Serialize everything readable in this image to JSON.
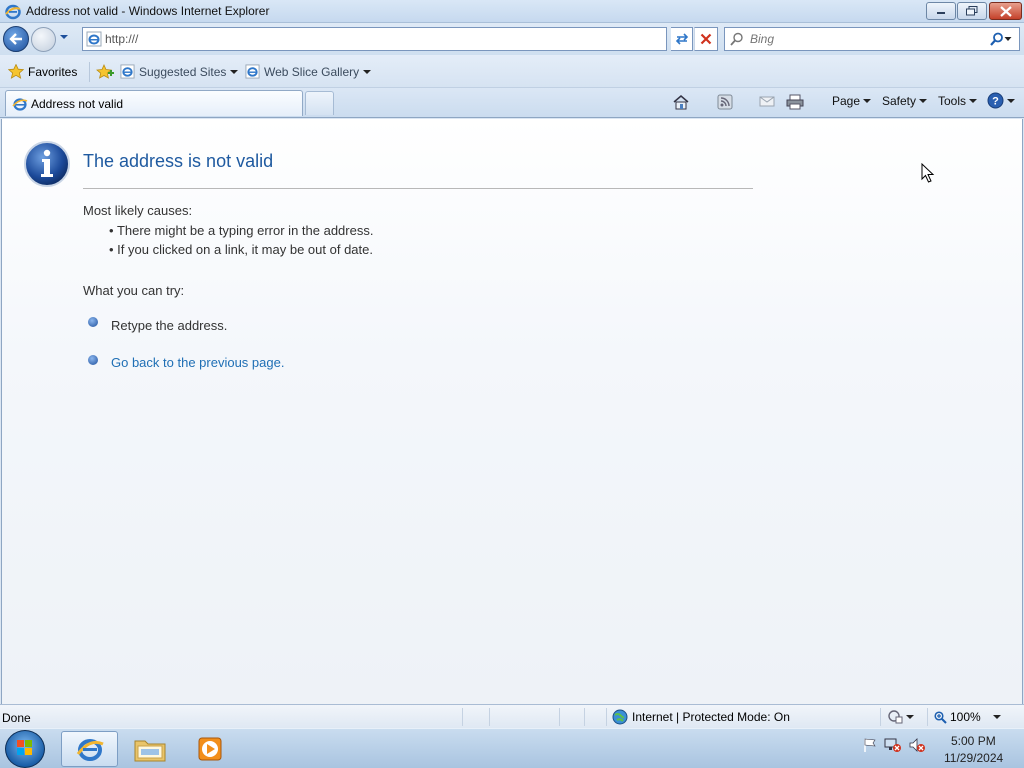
{
  "window": {
    "title": "Address not valid - Windows Internet Explorer"
  },
  "navigation": {
    "address_value": "http:///",
    "search_placeholder": "Bing"
  },
  "favorites_bar": {
    "favorites_label": "Favorites",
    "items": [
      {
        "label": "Suggested Sites"
      },
      {
        "label": "Web Slice Gallery"
      }
    ]
  },
  "tabs": [
    {
      "label": "Address not valid"
    }
  ],
  "command_bar": {
    "page_label": "Page",
    "safety_label": "Safety",
    "tools_label": "Tools"
  },
  "error_page": {
    "title": "The address is not valid",
    "causes_heading": "Most likely causes:",
    "causes": [
      "There might be a typing error in the address.",
      "If you clicked on a link, it may be out of date."
    ],
    "try_heading": "What you can try:",
    "actions": [
      {
        "text": "Retype the address."
      },
      {
        "text": "Go back to the previous page."
      }
    ]
  },
  "status_bar": {
    "status": "Done",
    "zone": "Internet | Protected Mode: On",
    "zoom": "100%"
  },
  "taskbar": {
    "time": "5:00 PM",
    "date": "11/29/2024"
  },
  "colors": {
    "title_blue": "#1f5aa0",
    "link_blue": "#1f6fb5"
  }
}
